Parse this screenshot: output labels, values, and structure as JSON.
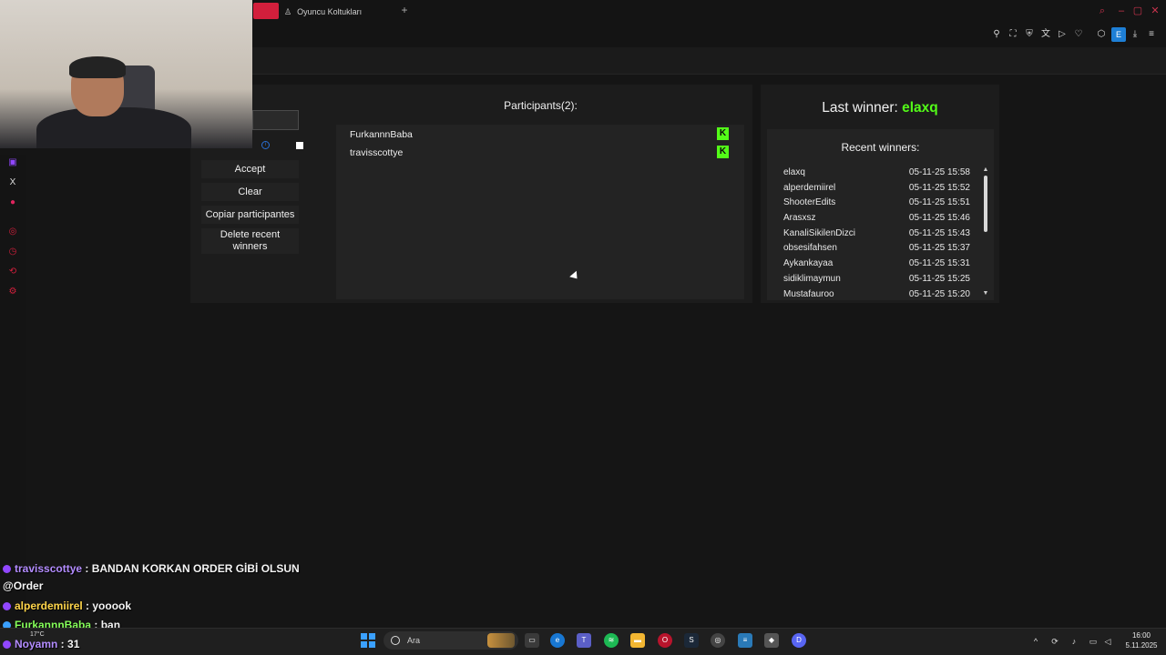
{
  "browser": {
    "tab_title": "Oyuncu Koltukları",
    "new_tab": "+",
    "profile_letter": "E",
    "window_controls": [
      "search-icon",
      "minimize-icon",
      "maximize-icon",
      "close-icon"
    ]
  },
  "controls": {
    "keyword_value": "",
    "accept_label": "Accept",
    "clear_label": "Clear",
    "copy_label": "Copiar participantes",
    "delete_label": "Delete recent winners"
  },
  "participants": {
    "title": "Participants(2):",
    "items": [
      {
        "name": "FurkannnBaba",
        "platform_icon": "kick-icon"
      },
      {
        "name": "travisscottye",
        "platform_icon": "kick-icon"
      }
    ]
  },
  "winners": {
    "last_winner_label": "Last winner:",
    "last_winner_name": "elaxq",
    "recent_title": "Recent winners:",
    "recent": [
      {
        "name": "elaxq",
        "time": "05-11-25 15:58"
      },
      {
        "name": "alperdemiirel",
        "time": "05-11-25 15:52"
      },
      {
        "name": "ShooterEdits",
        "time": "05-11-25 15:51"
      },
      {
        "name": "Arasxsz",
        "time": "05-11-25 15:46"
      },
      {
        "name": "KanaliSikilenDizci",
        "time": "05-11-25 15:43"
      },
      {
        "name": "obsesifahsen",
        "time": "05-11-25 15:37"
      },
      {
        "name": "Aykankayaa",
        "time": "05-11-25 15:31"
      },
      {
        "name": "sidiklimaymun",
        "time": "05-11-25 15:25"
      },
      {
        "name": "Mustafauroo",
        "time": "05-11-25 15:20"
      }
    ]
  },
  "chat": [
    {
      "user": "travisscottye",
      "message": "BANDAN KORKAN ORDER GİBİ OLSUN"
    },
    {
      "user": "",
      "message": "@Order"
    },
    {
      "user": "alperdemiirel",
      "message": "yooook"
    },
    {
      "user": "FurkannnBaba",
      "message": "ban"
    },
    {
      "user": "Noyamn",
      "message": "31"
    }
  ],
  "taskbar": {
    "weather": "17°C",
    "search_placeholder": "Ara",
    "time": "16:00",
    "date": "5.11.2025"
  },
  "colors": {
    "kick_green": "#53fc18",
    "accent_red": "#d21f3c",
    "panel_bg": "#1c1c1c"
  }
}
